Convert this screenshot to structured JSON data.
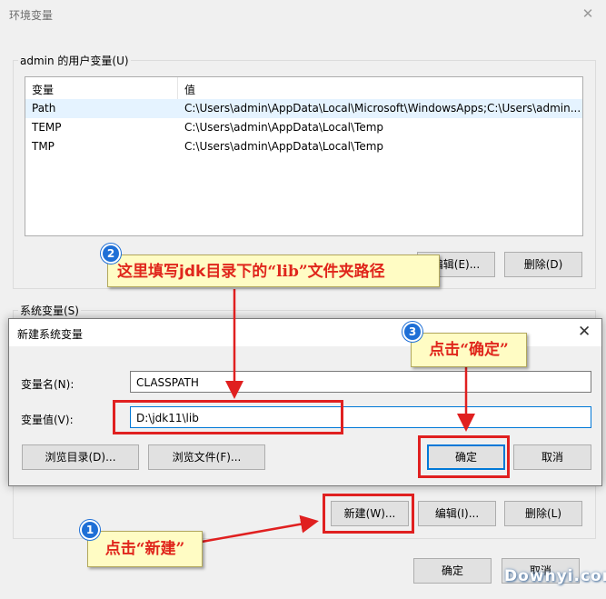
{
  "window": {
    "title": "环境变量",
    "close": "✕"
  },
  "user_vars": {
    "label": "admin 的用户变量(U)",
    "columns": [
      "变量",
      "值"
    ],
    "rows": [
      {
        "name": "Path",
        "value": "C:\\Users\\admin\\AppData\\Local\\Microsoft\\WindowsApps;C:\\Users\\admin..."
      },
      {
        "name": "TEMP",
        "value": "C:\\Users\\admin\\AppData\\Local\\Temp"
      },
      {
        "name": "TMP",
        "value": "C:\\Users\\admin\\AppData\\Local\\Temp"
      }
    ],
    "edit_label": "编辑(E)...",
    "delete_label": "删除(D)"
  },
  "system_vars": {
    "label": "系统变量(S)",
    "new_label": "新建(W)...",
    "edit_label": "编辑(I)...",
    "delete_label": "删除(L)"
  },
  "footer": {
    "ok_label": "确定",
    "cancel_label": "取消"
  },
  "dialog": {
    "title": "新建系统变量",
    "close": "✕",
    "name_label": "变量名(N):",
    "name_value": "CLASSPATH",
    "value_label": "变量值(V):",
    "value_value": "D:\\jdk11\\lib",
    "browse_dir_label": "浏览目录(D)...",
    "browse_file_label": "浏览文件(F)...",
    "ok_label": "确定",
    "cancel_label": "取消"
  },
  "annotations": {
    "step1": {
      "badge": "1",
      "text": "点击“新建”"
    },
    "step2": {
      "badge": "2",
      "text_pre": "这里填写",
      "text_bold": "jdk",
      "text_mid": "目录下的",
      "text_q": "“lib”",
      "text_post": "文件夹路径"
    },
    "step3": {
      "badge": "3",
      "text": "点击“确定”"
    },
    "highlight_color": "#e02020",
    "callout_bg": "#fffcc4"
  },
  "watermark": "Downyi.com"
}
